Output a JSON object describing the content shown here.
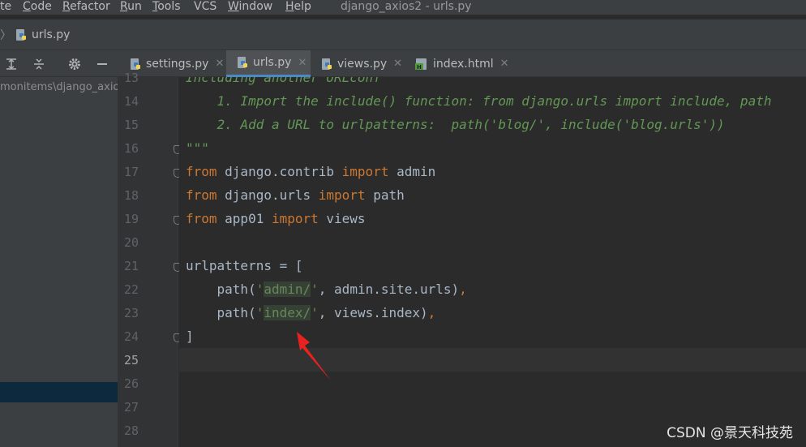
{
  "menubar": {
    "items": [
      {
        "label": "te",
        "underline": ""
      },
      {
        "label": "ode",
        "underline": "C"
      },
      {
        "label": "efactor",
        "underline": "R"
      },
      {
        "label": "un",
        "underline": "R"
      },
      {
        "label": "ools",
        "underline": "T"
      },
      {
        "label": "VCS",
        "underline": ""
      },
      {
        "label": "indow",
        "underline": "W"
      },
      {
        "label": "elp",
        "underline": "H"
      }
    ],
    "window_title": "django_axios2 - urls.py"
  },
  "breadcrumb": {
    "file": "urls.py",
    "separator": "〉"
  },
  "project_panel": {
    "path": "monitems\\django_axios"
  },
  "tabs": [
    {
      "label": "settings.py",
      "icon": "python-file-icon",
      "active": false
    },
    {
      "label": "urls.py",
      "icon": "python-file-icon",
      "active": true
    },
    {
      "label": "views.py",
      "icon": "python-file-icon",
      "active": false
    },
    {
      "label": "index.html",
      "icon": "html-file-icon",
      "active": false
    }
  ],
  "editor": {
    "current_line": 25,
    "lines": [
      {
        "no": "13",
        "tokens": [
          {
            "t": "Including another URLconf",
            "c": "doc"
          }
        ]
      },
      {
        "no": "14",
        "tokens": [
          {
            "t": "    1. Import the include() function: from django.urls import include, path",
            "c": "doc"
          }
        ]
      },
      {
        "no": "15",
        "tokens": [
          {
            "t": "    2. Add a URL to urlpatterns:  path('blog/', include('blog.urls'))",
            "c": "doc"
          }
        ]
      },
      {
        "no": "16",
        "fold": true,
        "tokens": [
          {
            "t": "\"\"\"",
            "c": "doc"
          }
        ]
      },
      {
        "no": "17",
        "fold": true,
        "tokens": [
          {
            "t": "from",
            "c": "kw"
          },
          {
            "t": " django.contrib ",
            "c": ""
          },
          {
            "t": "import",
            "c": "kw"
          },
          {
            "t": " admin",
            "c": ""
          }
        ]
      },
      {
        "no": "18",
        "tokens": [
          {
            "t": "from",
            "c": "kw"
          },
          {
            "t": " django.urls ",
            "c": ""
          },
          {
            "t": "import",
            "c": "kw"
          },
          {
            "t": " path",
            "c": ""
          }
        ]
      },
      {
        "no": "19",
        "fold": true,
        "tokens": [
          {
            "t": "from",
            "c": "kw"
          },
          {
            "t": " app01 ",
            "c": ""
          },
          {
            "t": "import",
            "c": "kw"
          },
          {
            "t": " views",
            "c": ""
          }
        ]
      },
      {
        "no": "20",
        "tokens": []
      },
      {
        "no": "21",
        "fold": true,
        "tokens": [
          {
            "t": "urlpatterns = [",
            "c": ""
          }
        ]
      },
      {
        "no": "22",
        "tokens": [
          {
            "t": "    path(",
            "c": ""
          },
          {
            "t": "'",
            "c": "str"
          },
          {
            "t": "admin/",
            "c": "str hl"
          },
          {
            "t": "'",
            "c": "str"
          },
          {
            "t": ", admin.site.urls)",
            "c": ""
          },
          {
            "t": ",",
            "c": "kw"
          }
        ]
      },
      {
        "no": "23",
        "tokens": [
          {
            "t": "    path(",
            "c": ""
          },
          {
            "t": "'",
            "c": "str"
          },
          {
            "t": "index/",
            "c": "str hl"
          },
          {
            "t": "'",
            "c": "str"
          },
          {
            "t": ", views.index)",
            "c": ""
          },
          {
            "t": ",",
            "c": "kw"
          }
        ]
      },
      {
        "no": "24",
        "fold": true,
        "tokens": [
          {
            "t": "]",
            "c": ""
          }
        ]
      },
      {
        "no": "25",
        "tokens": []
      },
      {
        "no": "26",
        "tokens": []
      },
      {
        "no": "27",
        "tokens": []
      },
      {
        "no": "28",
        "tokens": []
      }
    ]
  },
  "annotation": {
    "arrow_color": "#e8231f"
  },
  "watermark": "CSDN @景天科技苑",
  "colors": {
    "keyword": "#cc7832",
    "string": "#6a8759",
    "docstring": "#629755",
    "identifier": "#a9b7c6",
    "accent": "#4a88c7"
  }
}
